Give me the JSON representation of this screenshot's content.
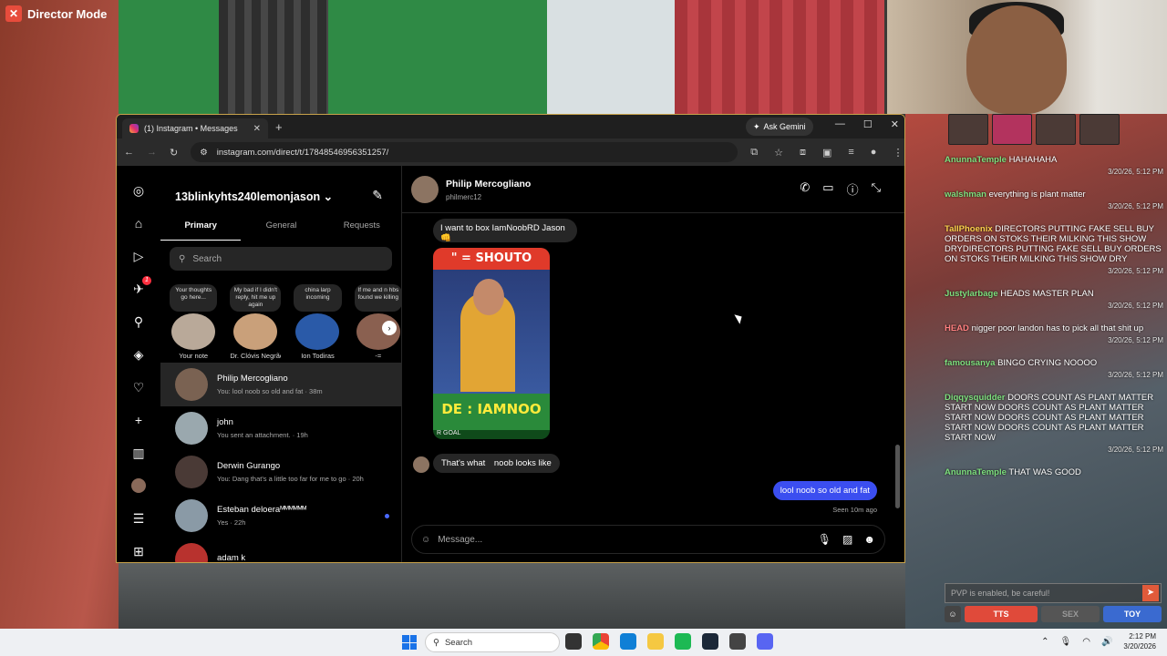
{
  "overlay": {
    "director_mode": "Director Mode",
    "stream_chat": [
      {
        "name": "AnunnaTemple",
        "text": "HAHAHAHA",
        "ts": "3/20/26, 5:12 PM",
        "color": "green"
      },
      {
        "name": "walshman",
        "text": "everything is plant matter",
        "ts": "3/20/26, 5:12 PM",
        "color": "green"
      },
      {
        "name": "TallPhoenix",
        "text": "DIRECTORS PUTTING FAKE SELL BUY ORDERS ON STOKS THEIR MILKING THIS SHOW DRYDIRECTORS PUTTING FAKE SELL BUY ORDERS ON STOKS THEIR MILKING THIS SHOW DRY",
        "ts": "3/20/26, 5:12 PM",
        "color": "gold"
      },
      {
        "name": "Justylarbage",
        "text": "HEADS MASTER PLAN",
        "ts": "3/20/26, 5:12 PM",
        "color": "green"
      },
      {
        "name": "HEAD",
        "text": "nigger poor landon has to pick all that shit up",
        "ts": "3/20/26, 5:12 PM",
        "color": "red"
      },
      {
        "name": "famousanya",
        "text": "BINGO CRYING NOOOO",
        "ts": "3/20/26, 5:12 PM",
        "color": "green"
      },
      {
        "name": "Diqqysquidder",
        "text": "DOORS COUNT AS PLANT MATTER START NOW DOORS COUNT AS PLANT MATTER START NOW DOORS COUNT AS PLANT MATTER START NOW DOORS COUNT AS PLANT MATTER START NOW",
        "ts": "3/20/26, 5:12 PM",
        "color": "green"
      },
      {
        "name": "AnunnaTemple",
        "text": "THAT WAS GOOD",
        "ts": "",
        "color": "green"
      }
    ],
    "pvp_placeholder": "PVP is enabled, be careful!",
    "buttons": {
      "tts": "TTS",
      "sex": "SEX",
      "toy": "TOY"
    }
  },
  "browser": {
    "tab_title": "(1) Instagram • Messages",
    "ask_gemini": "Ask Gemini",
    "url": "instagram.com/direct/t/17848546956351257/"
  },
  "instagram": {
    "account": "13blinkyhts240lemonjason",
    "tabs": [
      "Primary",
      "General",
      "Requests"
    ],
    "search_placeholder": "Search",
    "notes": [
      {
        "bubble": "Your thoughts go here...",
        "label": "Your note"
      },
      {
        "bubble": "My bad if I didn't reply, hit me up again",
        "label": "Dr. Clóvis Negrão"
      },
      {
        "bubble": "china larp incoming",
        "label": "Ion Todiras"
      },
      {
        "bubble": "If me and n hbs found we killing",
        "label": "-="
      }
    ],
    "threads": [
      {
        "name": "Philip Mercogliano",
        "preview": "You: lool noob so old and fat · 38m",
        "unread": false
      },
      {
        "name": "john",
        "preview": "You sent an attachment. · 19h",
        "unread": false
      },
      {
        "name": "Derwin Gurango",
        "preview": "You: Dang that's a little too far for me to go · 20h",
        "unread": false
      },
      {
        "name": "Esteban deloeraᴹᴹᴹᴹᴹᴹ",
        "preview": "Yes · 22h",
        "unread": true
      },
      {
        "name": "adam k",
        "preview": "",
        "unread": false
      }
    ],
    "conversation": {
      "name": "Philip Mercogliano",
      "username": "philmerc12",
      "messages": {
        "m1": "I want to box IamNoobRD Jason 👊",
        "video_top": "\" = SHOUTO",
        "video_bottom": "DE : IAMNOO",
        "video_goal": "R GOAL",
        "m2": "That's what⠀ noob looks like",
        "m3": "lool noob so old and fat"
      },
      "seen": "Seen 10m ago",
      "composer_placeholder": "Message..."
    }
  },
  "taskbar": {
    "search": "Search",
    "time": "2:12 PM",
    "date": "3/20/2026"
  }
}
